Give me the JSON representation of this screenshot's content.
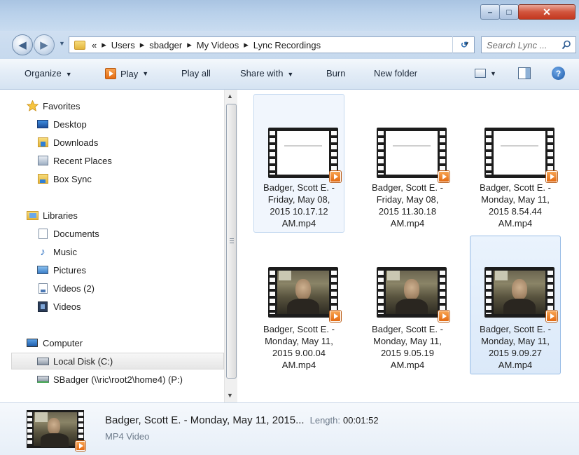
{
  "window": {
    "title": "",
    "minimize": "–",
    "maximize": "□",
    "close": "✕"
  },
  "address": {
    "chevron": "«",
    "breadcrumbs": [
      "Users",
      "sbadger",
      "My Videos",
      "Lync Recordings"
    ],
    "separator": "▸",
    "search_placeholder": "Search Lync ..."
  },
  "toolbar": {
    "organize": "Organize",
    "play": "Play",
    "play_all": "Play all",
    "share_with": "Share with",
    "burn": "Burn",
    "new_folder": "New folder",
    "help": "?"
  },
  "nav": {
    "favorites": {
      "label": "Favorites",
      "items": [
        "Desktop",
        "Downloads",
        "Recent Places",
        "Box Sync"
      ]
    },
    "libraries": {
      "label": "Libraries",
      "items": [
        "Documents",
        "Music",
        "Pictures",
        "Videos (2)",
        "Videos"
      ]
    },
    "computer": {
      "label": "Computer",
      "items": [
        "Local Disk (C:)",
        "SBadger (\\\\ric\\root2\\home4) (P:)"
      ]
    }
  },
  "files": [
    {
      "lines": [
        "Badger, Scott E. -",
        "Friday, May 08,",
        "2015 10.17.12",
        "AM.mp4"
      ],
      "thumb": "white",
      "state": "hover"
    },
    {
      "lines": [
        "Badger, Scott E. -",
        "Friday, May 08,",
        "2015 11.30.18",
        "AM.mp4"
      ],
      "thumb": "white",
      "state": "normal"
    },
    {
      "lines": [
        "Badger, Scott E. -",
        "Monday, May 11,",
        "2015 8.54.44",
        "AM.mp4"
      ],
      "thumb": "white",
      "state": "normal"
    },
    {
      "lines": [
        "Badger, Scott E. -",
        "Monday, May 11,",
        "2015 9.00.04",
        "AM.mp4"
      ],
      "thumb": "photo",
      "state": "normal"
    },
    {
      "lines": [
        "Badger, Scott E. -",
        "Monday, May 11,",
        "2015 9.05.19",
        "AM.mp4"
      ],
      "thumb": "photo",
      "state": "normal"
    },
    {
      "lines": [
        "Badger, Scott E. -",
        "Monday, May 11,",
        "2015 9.09.27",
        "AM.mp4"
      ],
      "thumb": "photo",
      "state": "selected"
    }
  ],
  "details": {
    "title": "Badger, Scott E. - Monday, May 11, 2015...",
    "length_label": "Length:",
    "length": "00:01:52",
    "type": "MP4 Video"
  },
  "colors": {
    "selection": "#dbe9f9",
    "selection_border": "#99bde6",
    "accent_orange": "#e46b12",
    "frame_blue": "#b8d0ea"
  }
}
